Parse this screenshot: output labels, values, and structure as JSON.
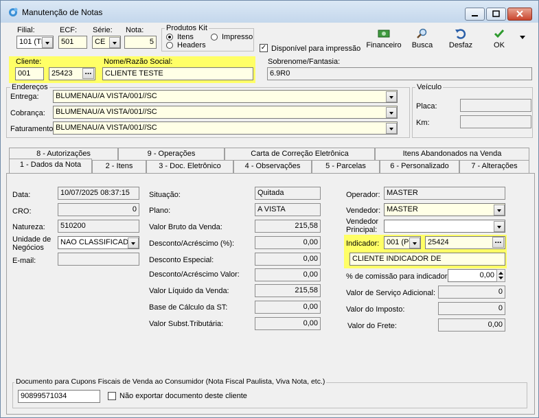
{
  "window": {
    "title": "Manutenção de Notas"
  },
  "header": {
    "filial_label": "Filial:",
    "filial_value": "101 (TI",
    "ecf_label": "ECF:",
    "ecf_value": "501",
    "serie_label": "Série:",
    "serie_value": "CE",
    "nota_label": "Nota:",
    "nota_value": "5",
    "produtos_kit_label": "Produtos Kit",
    "opt_itens": "Itens",
    "opt_headers": "Headers",
    "opt_impresso": "Impresso",
    "disponivel_label": "Disponível para impressão"
  },
  "toolbar": {
    "financeiro": "Financeiro",
    "busca": "Busca",
    "desfaz": "Desfaz",
    "ok": "OK"
  },
  "cliente": {
    "label": "Cliente:",
    "code1": "001",
    "code2": "25423",
    "nome_label": "Nome/Razão Social:",
    "nome_value": "CLIENTE TESTE",
    "sobrenome_label": "Sobrenome/Fantasia:",
    "sobrenome_value": "6.9R0"
  },
  "enderecos": {
    "title": "Endereços",
    "entrega_label": "Entrega:",
    "entrega_value": "BLUMENAU/A VISTA/001//SC",
    "cobranca_label": "Cobrança:",
    "cobranca_value": "BLUMENAU/A VISTA/001//SC",
    "faturamento_label": "Faturamento:",
    "faturamento_value": "BLUMENAU/A VISTA/001//SC"
  },
  "veiculo": {
    "title": "Veículo",
    "placa_label": "Placa:",
    "km_label": "Km:"
  },
  "tabs_row1": [
    "8 - Autorizações",
    "9 - Operações",
    "Carta de Correção Eletrônica",
    "Itens Abandonados na Venda"
  ],
  "tabs_row2": [
    "1 - Dados da Nota",
    "2 - Itens",
    "3 - Doc. Eletrônico",
    "4 - Observações",
    "5 - Parcelas",
    "6 - Personalizado",
    "7 - Alterações"
  ],
  "col1": {
    "data_label": "Data:",
    "data_value": "10/07/2025 08:37:15",
    "cro_label": "CRO:",
    "cro_value": "0",
    "natureza_label": "Natureza:",
    "natureza_value": "510200",
    "unidade_label1": "Unidade de",
    "unidade_label2": "Negócios",
    "unidade_value": "NAO CLASSIFICADO",
    "email_label": "E-mail:"
  },
  "col2": {
    "situacao_label": "Situação:",
    "situacao_value": "Quitada",
    "plano_label": "Plano:",
    "plano_value": "A VISTA",
    "bruto_label": "Valor Bruto da Venda:",
    "bruto_value": "215,58",
    "desc_pct_label": "Desconto/Acréscimo (%):",
    "desc_pct_value": "0,00",
    "desc_esp_label": "Desconto Especial:",
    "desc_esp_value": "0,00",
    "desc_val_label": "Desconto/Acréscimo Valor:",
    "desc_val_value": "0,00",
    "liquido_label": "Valor Líquido da Venda:",
    "liquido_value": "215,58",
    "base_st_label": "Base de Cálculo da ST:",
    "base_st_value": "0,00",
    "subst_label": "Valor Subst.Tributária:",
    "subst_value": "0,00"
  },
  "col3": {
    "operador_label": "Operador:",
    "operador_value": "MASTER",
    "vendedor_label": "Vendedor:",
    "vendedor_value": "MASTER",
    "vend_princ_label1": "Vendedor",
    "vend_princ_label2": "Principal:",
    "indicador_label": "Indicador:",
    "indicador_code1": "001 (PI",
    "indicador_code2": "25424",
    "indicador_nome": "CLIENTE INDICADOR DE",
    "comissao_label": "% de comissão para indicador:",
    "comissao_value": "0,00",
    "servico_label": "Valor de Serviço Adicional:",
    "servico_value": "0",
    "imposto_label": "Valor do Imposto:",
    "imposto_value": "0",
    "frete_label": "Valor do Frete:",
    "frete_value": "0,00"
  },
  "documento": {
    "title": "Documento para Cupons Fiscais de Venda ao Consumidor (Nota Fiscal Paulista, Viva Nota, etc.)",
    "value": "90899571034",
    "nao_exportar_label": "Não exportar documento deste cliente"
  }
}
